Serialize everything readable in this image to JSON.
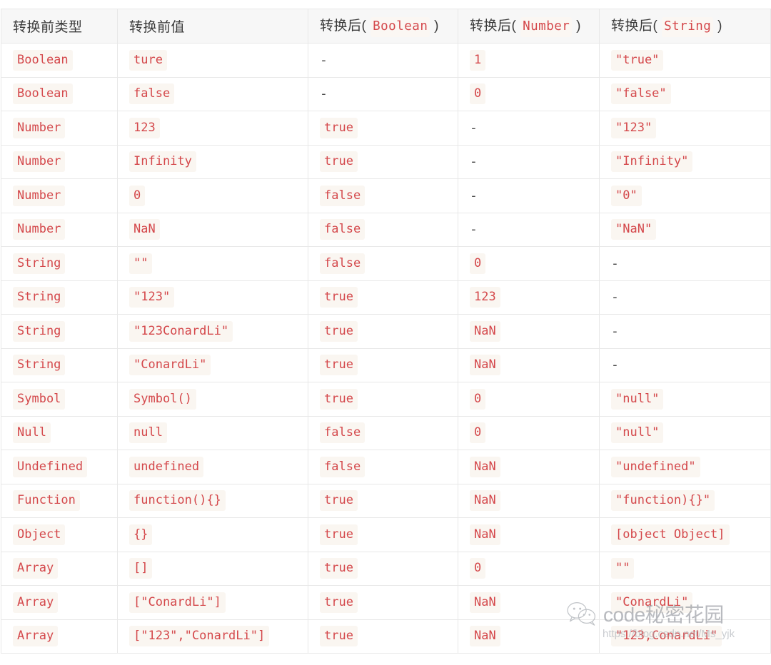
{
  "table": {
    "headers": [
      {
        "text": "转换前类型",
        "code": null,
        "suffix": null
      },
      {
        "text": "转换前值",
        "code": null,
        "suffix": null
      },
      {
        "text": "转换后( ",
        "code": "Boolean",
        "suffix": " )"
      },
      {
        "text": "转换后( ",
        "code": "Number",
        "suffix": " )"
      },
      {
        "text": "转换后( ",
        "code": "String",
        "suffix": " )"
      }
    ],
    "rows": [
      {
        "type": "Boolean",
        "value": "ture",
        "boolean": "-",
        "number": "1",
        "string": "\"true\""
      },
      {
        "type": "Boolean",
        "value": "false",
        "boolean": "-",
        "number": "0",
        "string": "\"false\""
      },
      {
        "type": "Number",
        "value": "123",
        "boolean": "true",
        "number": "-",
        "string": "\"123\""
      },
      {
        "type": "Number",
        "value": "Infinity",
        "boolean": "true",
        "number": "-",
        "string": "\"Infinity\""
      },
      {
        "type": "Number",
        "value": "0",
        "boolean": "false",
        "number": "-",
        "string": "\"0\""
      },
      {
        "type": "Number",
        "value": "NaN",
        "boolean": "false",
        "number": "-",
        "string": "\"NaN\""
      },
      {
        "type": "String",
        "value": "\"\"",
        "boolean": "false",
        "number": "0",
        "string": "-"
      },
      {
        "type": "String",
        "value": "\"123\"",
        "boolean": "true",
        "number": "123",
        "string": "-"
      },
      {
        "type": "String",
        "value": "\"123ConardLi\"",
        "boolean": "true",
        "number": "NaN",
        "string": "-"
      },
      {
        "type": "String",
        "value": "\"ConardLi\"",
        "boolean": "true",
        "number": "NaN",
        "string": "-"
      },
      {
        "type": "Symbol",
        "value": "Symbol()",
        "boolean": "true",
        "number": "0",
        "string": "\"null\""
      },
      {
        "type": "Null",
        "value": "null",
        "boolean": "false",
        "number": "0",
        "string": "\"null\""
      },
      {
        "type": "Undefined",
        "value": "undefined",
        "boolean": "false",
        "number": "NaN",
        "string": "\"undefined\""
      },
      {
        "type": "Function",
        "value": "function(){}",
        "boolean": "true",
        "number": "NaN",
        "string": "\"function){}\""
      },
      {
        "type": "Object",
        "value": "{}",
        "boolean": "true",
        "number": "NaN",
        "string": "[object Object]"
      },
      {
        "type": "Array",
        "value": "[]",
        "boolean": "true",
        "number": "0",
        "string": "\"\""
      },
      {
        "type": "Array",
        "value": "[\"ConardLi\"]",
        "boolean": "true",
        "number": "NaN",
        "string": "\"ConardLi\""
      },
      {
        "type": "Array",
        "value": "[\"123\",\"ConardLi\"]",
        "boolean": "true",
        "number": "NaN",
        "string": "\"123,ConardLi\""
      }
    ]
  },
  "watermark": {
    "title": "code秘密花园",
    "url": "https://blog.csdn.net/Ms_yjk"
  },
  "colors": {
    "code_text": "#d4484b",
    "code_background": "#faf6f1",
    "header_background": "#f7f7f7",
    "border": "#e8e8e8",
    "header_text": "#3b3b3b",
    "dash_text": "#4a4a4a"
  }
}
